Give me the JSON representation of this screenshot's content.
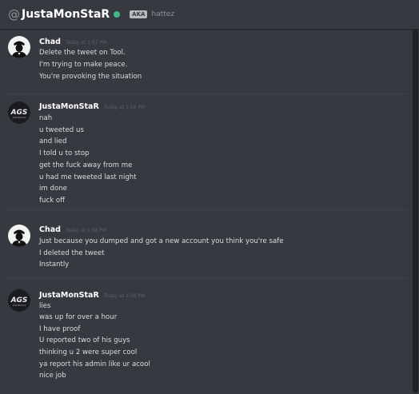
{
  "header": {
    "at": "@",
    "username": "JustaMonStaR",
    "aka_label": "AKA",
    "alias": "hattez",
    "status_color": "#43b581"
  },
  "messages": [
    {
      "author": "Chad",
      "timestamp": "Today at 1:57 PM",
      "avatar_icon": "godfather-silhouette-icon",
      "lines": [
        "Delete the tweet on Tool.",
        "I'm trying to make peace.",
        "You're provoking the situation"
      ]
    },
    {
      "author": "JustaMonStaR",
      "timestamp": "Today at 1:58 PM",
      "avatar_icon": "ags-logo-icon",
      "lines": [
        "nah",
        "u tweeted us",
        "and lied",
        "I told u to stop",
        "get the fuck away from me",
        "u had me tweeted last night",
        "im done",
        "fuck off"
      ]
    },
    {
      "author": "Chad",
      "timestamp": "Today at 1:58 PM",
      "avatar_icon": "godfather-silhouette-icon",
      "lines": [
        "Just because you dumped and got a new account you think you're safe",
        "I deleted the tweet",
        "Instantly"
      ]
    },
    {
      "author": "JustaMonStaR",
      "timestamp": "Today at 1:58 PM",
      "avatar_icon": "ags-logo-icon",
      "lines": [
        "lies",
        "was up for over a hour",
        "I have proof",
        "U reported two of his guys",
        "thinking u 2 were super cool",
        "ya report his admin like ur acool",
        "nice job"
      ]
    }
  ],
  "ags_logo_text": "AGS",
  "ags_logo_subtext": "AMSTERDAM"
}
